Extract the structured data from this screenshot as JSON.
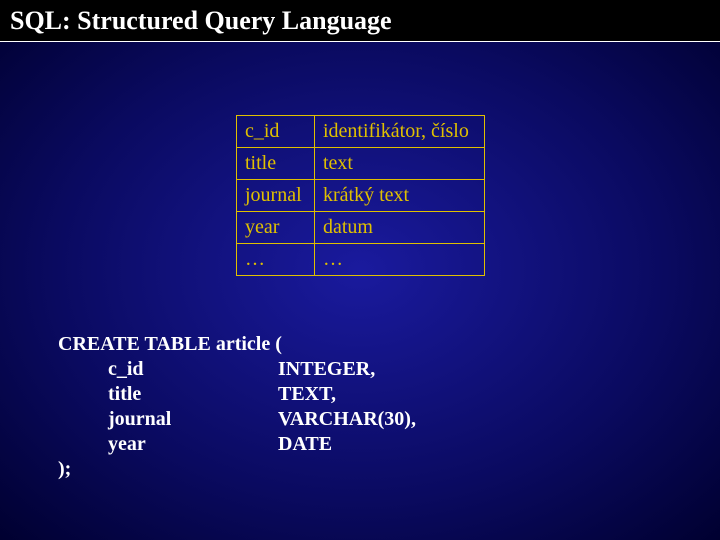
{
  "title": "SQL: Structured Query Language",
  "table": {
    "rows": [
      {
        "field": "c_id",
        "desc": "identifikátor, číslo"
      },
      {
        "field": "title",
        "desc": "text"
      },
      {
        "field": "journal",
        "desc": "krátký text"
      },
      {
        "field": "year",
        "desc": "datum"
      },
      {
        "field": "…",
        "desc": "…"
      }
    ]
  },
  "code": {
    "line0": "CREATE TABLE article (",
    "col_indent": "          ",
    "cols": [
      {
        "name": "c_id",
        "type": "INTEGER,"
      },
      {
        "name": "title",
        "type": "TEXT,"
      },
      {
        "name": "journal",
        "type": "VARCHAR(30),"
      },
      {
        "name": "year",
        "type": "DATE"
      }
    ],
    "line_end": ");"
  }
}
